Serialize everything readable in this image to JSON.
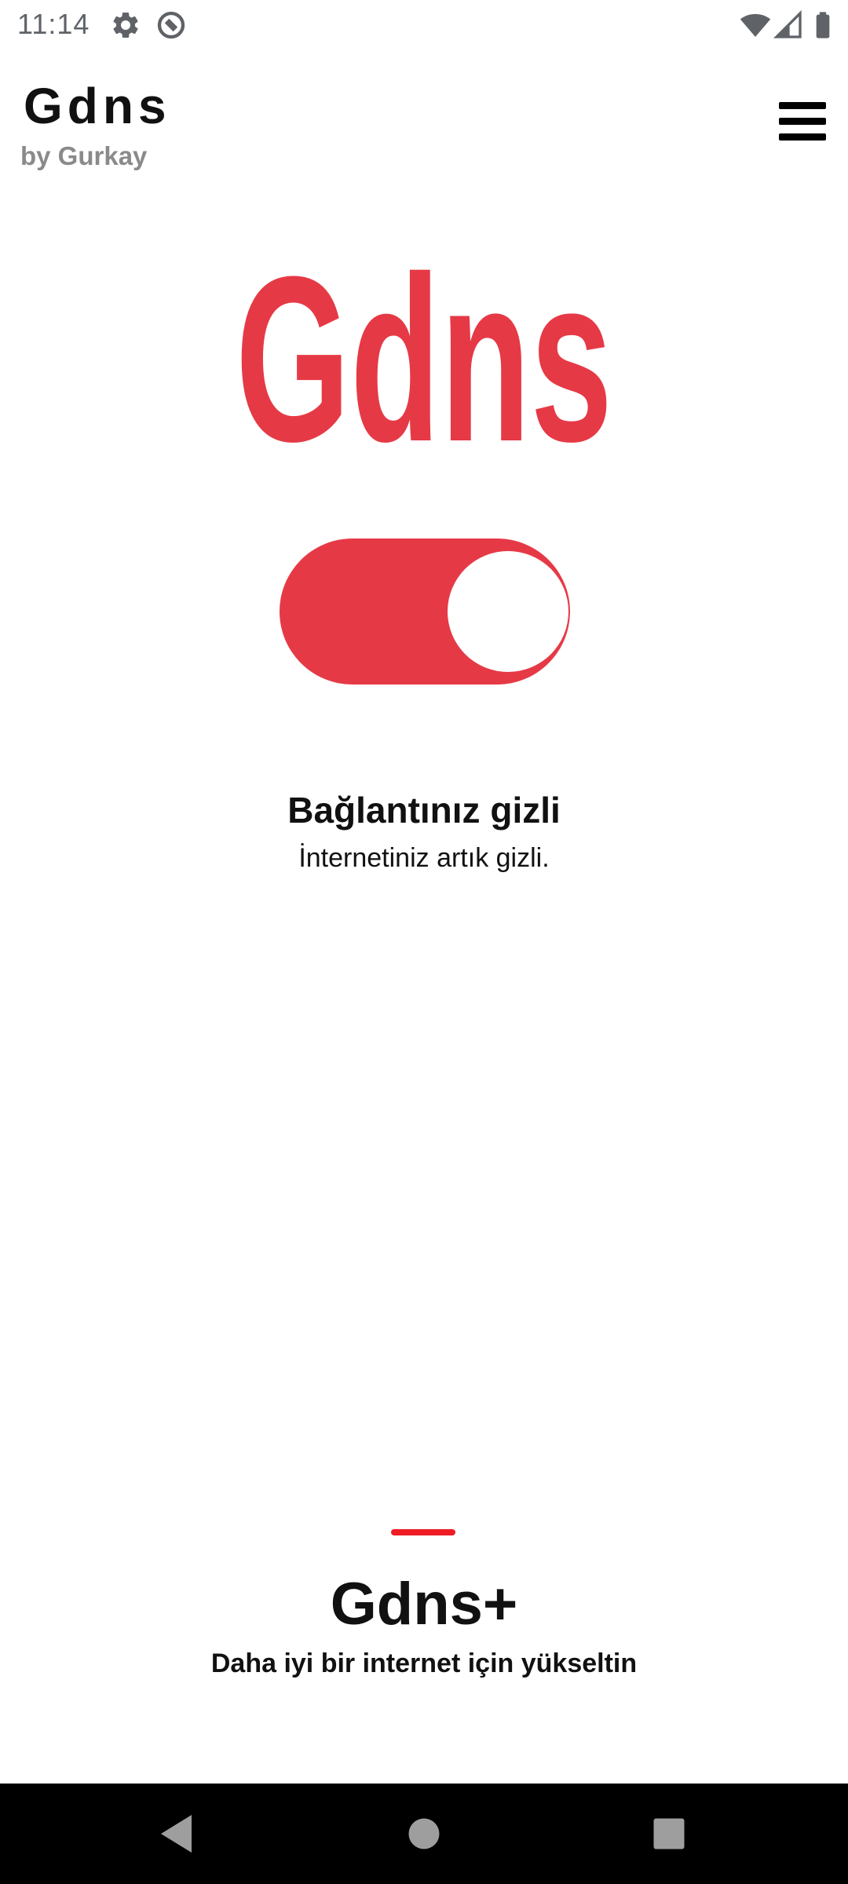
{
  "status_bar": {
    "time": "11:14",
    "icons": [
      "settings-icon",
      "do-not-disturb-icon",
      "wifi-icon",
      "cellular-signal-icon",
      "battery-icon"
    ],
    "icon_color": "#5f6368"
  },
  "header": {
    "title": "Gdns",
    "subtitle": "by Gurkay",
    "menu_icon": "hamburger-menu-icon"
  },
  "logo": {
    "text": "Gdns",
    "color": "#e63946"
  },
  "toggle": {
    "state": "on",
    "color": "#e63946"
  },
  "connection": {
    "title": "Bağlantınız gizli",
    "description": "İnternetiniz artık gizli."
  },
  "upgrade": {
    "title": "Gdns+",
    "description": "Daha iyi bir internet için yükseltin",
    "handle_color": "#ee1c25"
  },
  "nav_bar": {
    "back_icon": "back-triangle-icon",
    "home_icon": "home-circle-icon",
    "recents_icon": "recents-square-icon"
  }
}
